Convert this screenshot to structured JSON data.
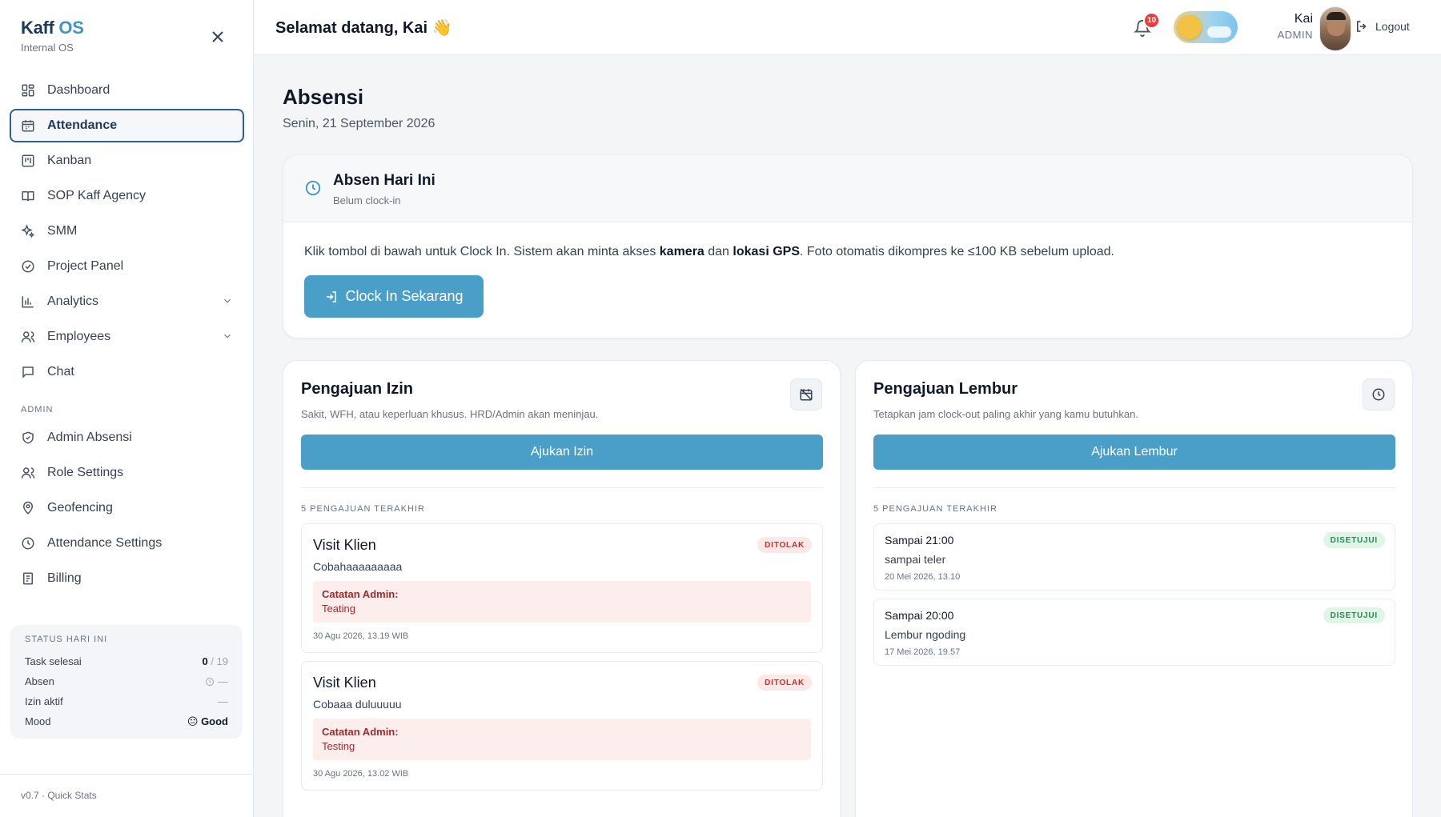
{
  "sidebar": {
    "brand_name": "Kaff",
    "brand_suffix": "OS",
    "brand_sub": "Internal OS",
    "nav": [
      {
        "label": "Dashboard",
        "icon": "dashboard-icon"
      },
      {
        "label": "Attendance",
        "icon": "calendar-icon",
        "active": true
      },
      {
        "label": "Kanban",
        "icon": "kanban-icon"
      },
      {
        "label": "SOP Kaff Agency",
        "icon": "book-icon"
      },
      {
        "label": "SMM",
        "icon": "sparkles-icon"
      },
      {
        "label": "Project Panel",
        "icon": "check-circle-icon"
      },
      {
        "label": "Analytics",
        "icon": "bar-chart-icon"
      },
      {
        "label": "Employees",
        "icon": "users-icon"
      },
      {
        "label": "Chat",
        "icon": "chat-icon"
      }
    ],
    "admin_section": "ADMIN",
    "admin_nav": [
      {
        "label": "Admin Absensi",
        "icon": "shield-icon"
      },
      {
        "label": "Role Settings",
        "icon": "users-icon"
      },
      {
        "label": "Geofencing",
        "icon": "map-pin-icon"
      },
      {
        "label": "Attendance Settings",
        "icon": "clock-icon"
      },
      {
        "label": "Billing",
        "icon": "receipt-icon"
      }
    ],
    "stats": {
      "title": "STATUS HARI INI",
      "task_label": "Task selesai",
      "task_done": "0",
      "task_total": "/ 19",
      "absen_label": "Absen",
      "absen_value": "—",
      "izin_label": "Izin aktif",
      "izin_value": "—",
      "mood_label": "Mood",
      "mood_emoji": "😐",
      "mood_value": "Good"
    },
    "footer": "v0.7 · Quick Stats"
  },
  "topbar": {
    "welcome": "Selamat datang, Kai 👋",
    "notif_count": "10",
    "user_name": "Kai",
    "user_role": "ADMIN",
    "logout": "Logout"
  },
  "page": {
    "title": "Absensi",
    "date": "Senin, 21 September 2026"
  },
  "absen": {
    "title": "Absen Hari Ini",
    "status": "Belum clock-in",
    "text_1": "Klik tombol di bawah untuk Clock In. Sistem akan minta akses ",
    "text_kamera": "kamera",
    "text_2": " dan ",
    "text_gps": "lokasi GPS",
    "text_3": ". Foto otomatis dikompres ke ≤100 KB sebelum upload.",
    "button": "Clock In Sekarang"
  },
  "izin": {
    "title": "Pengajuan Izin",
    "subtitle": "Sakit, WFH, atau keperluan khusus. HRD/Admin akan meninjau.",
    "button": "Ajukan Izin",
    "section": "5 PENGAJUAN TERAKHIR",
    "items": [
      {
        "title": "Visit Klien",
        "desc": "Cobahaaaaaaaaa",
        "badge": "DITOLAK",
        "note_label": "Catatan Admin:",
        "note": "Teating",
        "time": "30 Agu 2026, 13.19 WIB"
      },
      {
        "title": "Visit Klien",
        "desc": "Cobaaa duluuuuu",
        "badge": "DITOLAK",
        "note_label": "Catatan Admin:",
        "note": "Testing",
        "time": "30 Agu 2026, 13.02 WIB"
      }
    ]
  },
  "lembur": {
    "title": "Pengajuan Lembur",
    "subtitle": "Tetapkan jam clock-out paling akhir yang kamu butuhkan.",
    "button": "Ajukan Lembur",
    "section": "5 PENGAJUAN TERAKHIR",
    "items": [
      {
        "title": "Sampai 21:00",
        "desc": "sampai teler",
        "time": "20 Mei 2026, 13.10",
        "badge": "DISETUJUI"
      },
      {
        "title": "Sampai 20:00",
        "desc": "Lembur ngoding",
        "time": "17 Mei 2026, 19.57",
        "badge": "DISETUJUI"
      }
    ]
  },
  "colors": {
    "accent": "#4a9fc8",
    "brand": "#1f3a57",
    "danger": "#c53030",
    "success": "#2f855a"
  }
}
